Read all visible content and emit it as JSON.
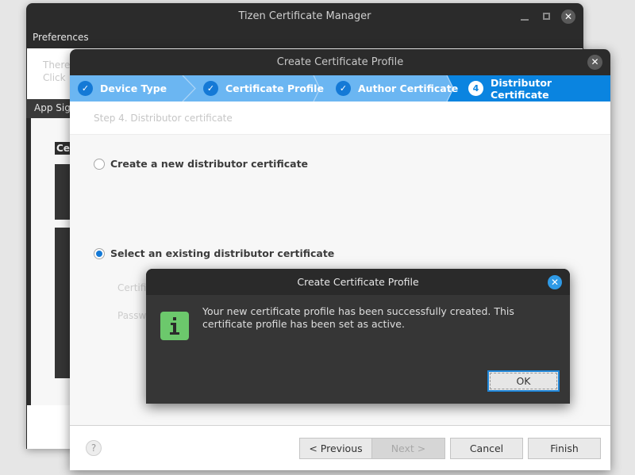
{
  "main_window": {
    "title": "Tizen Certificate Manager",
    "menu": "Preferences",
    "info_lines": [
      "There",
      "Click"
    ],
    "tab_label": "App Sig",
    "column_header": "Cer",
    "controls": {
      "minimize": "_",
      "maximize": "□",
      "close": "✕"
    }
  },
  "wizard": {
    "title": "Create Certificate Profile",
    "close": "✕",
    "steps": [
      {
        "label": "Device Type",
        "icon": "✓",
        "state": "done"
      },
      {
        "label": "Certificate Profile",
        "icon": "✓",
        "state": "done"
      },
      {
        "label": "Author Certificate",
        "icon": "✓",
        "state": "done"
      },
      {
        "label": "Distributor Certificate",
        "icon": "4",
        "state": "active"
      }
    ],
    "subtitle": "Step 4. Distributor certificate",
    "options": [
      {
        "label": "Create a new distributor certificate",
        "checked": false
      },
      {
        "label": "Select an existing distributor certificate",
        "checked": true
      }
    ],
    "field_labels": [
      "Certifi",
      "Passw"
    ],
    "footer": {
      "help": "?",
      "previous": "< Previous",
      "next": "Next >",
      "cancel": "Cancel",
      "finish": "Finish"
    }
  },
  "message_dialog": {
    "title": "Create Certificate Profile",
    "close": "✕",
    "icon": "info-icon",
    "text": "Your new certificate profile has been successfully created. This certificate profile has been set as active.",
    "ok": "OK"
  },
  "colors": {
    "step_done_bg": "#6bb6f2",
    "step_active_bg": "#0a84e0",
    "info_icon": "#6cc86c",
    "accent": "#1479d6"
  }
}
